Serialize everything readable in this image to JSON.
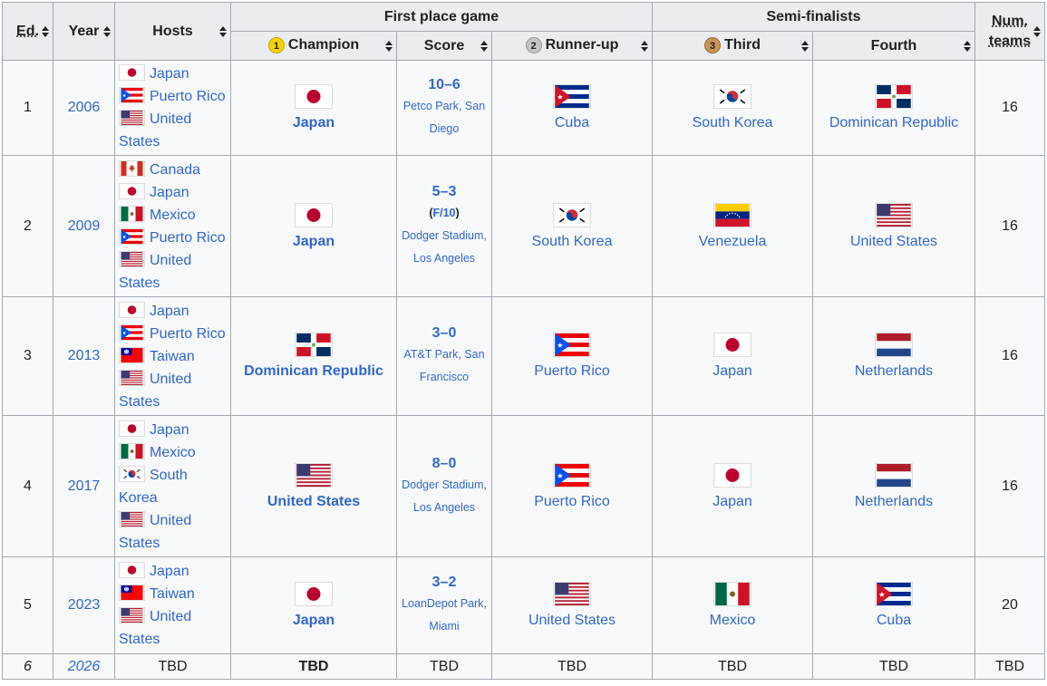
{
  "colors": {
    "link": "#3366cc",
    "header_bg": "#eaecf0",
    "cell_bg": "#f8f9fa",
    "border": "#a2a9b1"
  },
  "headers": {
    "ed": "Ed.",
    "year": "Year",
    "hosts": "Hosts",
    "first_place_game": "First place game",
    "semi_finalists": "Semi-finalists",
    "num_teams_line1": "Num.",
    "num_teams_line2": "teams",
    "champion": "Champion",
    "score": "Score",
    "runner_up": "Runner-up",
    "third": "Third",
    "fourth": "Fourth",
    "medal_1": "1",
    "medal_2": "2",
    "medal_3": "3"
  },
  "rows": [
    {
      "ed": "1",
      "year": "2006",
      "hosts": [
        {
          "flag": "japan",
          "name": "Japan"
        },
        {
          "flag": "puerto-rico",
          "name": "Puerto Rico"
        },
        {
          "flag": "usa",
          "name": "United States"
        }
      ],
      "champion": {
        "flag": "japan",
        "name": "Japan"
      },
      "score": "10–6",
      "ot": "",
      "venue": "Petco Park, San Diego",
      "runner_up": {
        "flag": "cuba",
        "name": "Cuba"
      },
      "third": {
        "flag": "south-korea",
        "name": "South Korea"
      },
      "fourth": {
        "flag": "dominican-republic",
        "name": "Dominican Republic"
      },
      "teams": "16"
    },
    {
      "ed": "2",
      "year": "2009",
      "hosts": [
        {
          "flag": "canada",
          "name": "Canada"
        },
        {
          "flag": "japan",
          "name": "Japan"
        },
        {
          "flag": "mexico",
          "name": "Mexico"
        },
        {
          "flag": "puerto-rico",
          "name": "Puerto Rico"
        },
        {
          "flag": "usa",
          "name": "United States"
        }
      ],
      "champion": {
        "flag": "japan",
        "name": "Japan"
      },
      "score": "5–3",
      "ot": "F/10",
      "venue": "Dodger Stadium, Los Angeles",
      "runner_up": {
        "flag": "south-korea",
        "name": "South Korea"
      },
      "third": {
        "flag": "venezuela",
        "name": "Venezuela"
      },
      "fourth": {
        "flag": "usa",
        "name": "United States"
      },
      "teams": "16"
    },
    {
      "ed": "3",
      "year": "2013",
      "hosts": [
        {
          "flag": "japan",
          "name": "Japan"
        },
        {
          "flag": "puerto-rico",
          "name": "Puerto Rico"
        },
        {
          "flag": "taiwan",
          "name": "Taiwan"
        },
        {
          "flag": "usa",
          "name": "United States"
        }
      ],
      "champion": {
        "flag": "dominican-republic",
        "name": "Dominican Republic"
      },
      "score": "3–0",
      "ot": "",
      "venue": "AT&T Park, San Francisco",
      "runner_up": {
        "flag": "puerto-rico",
        "name": "Puerto Rico"
      },
      "third": {
        "flag": "japan",
        "name": "Japan"
      },
      "fourth": {
        "flag": "netherlands",
        "name": "Netherlands"
      },
      "teams": "16"
    },
    {
      "ed": "4",
      "year": "2017",
      "hosts": [
        {
          "flag": "japan",
          "name": "Japan"
        },
        {
          "flag": "mexico",
          "name": "Mexico"
        },
        {
          "flag": "south-korea",
          "name": "South Korea"
        },
        {
          "flag": "usa",
          "name": "United States"
        }
      ],
      "champion": {
        "flag": "usa",
        "name": "United States"
      },
      "score": "8–0",
      "ot": "",
      "venue": "Dodger Stadium, Los Angeles",
      "runner_up": {
        "flag": "puerto-rico",
        "name": "Puerto Rico"
      },
      "third": {
        "flag": "japan",
        "name": "Japan"
      },
      "fourth": {
        "flag": "netherlands",
        "name": "Netherlands"
      },
      "teams": "16"
    },
    {
      "ed": "5",
      "year": "2023",
      "hosts": [
        {
          "flag": "japan",
          "name": "Japan"
        },
        {
          "flag": "taiwan",
          "name": "Taiwan"
        },
        {
          "flag": "usa",
          "name": "United States"
        }
      ],
      "champion": {
        "flag": "japan",
        "name": "Japan"
      },
      "score": "3–2",
      "ot": "",
      "venue": "LoanDepot Park, Miami",
      "runner_up": {
        "flag": "usa",
        "name": "United States"
      },
      "third": {
        "flag": "mexico",
        "name": "Mexico"
      },
      "fourth": {
        "flag": "cuba",
        "name": "Cuba"
      },
      "teams": "20"
    }
  ],
  "future_row": {
    "ed": "6",
    "year": "2026",
    "hosts": "TBD",
    "champion": "TBD",
    "score": "TBD",
    "runner_up": "TBD",
    "third": "TBD",
    "fourth": "TBD",
    "teams": "TBD"
  }
}
